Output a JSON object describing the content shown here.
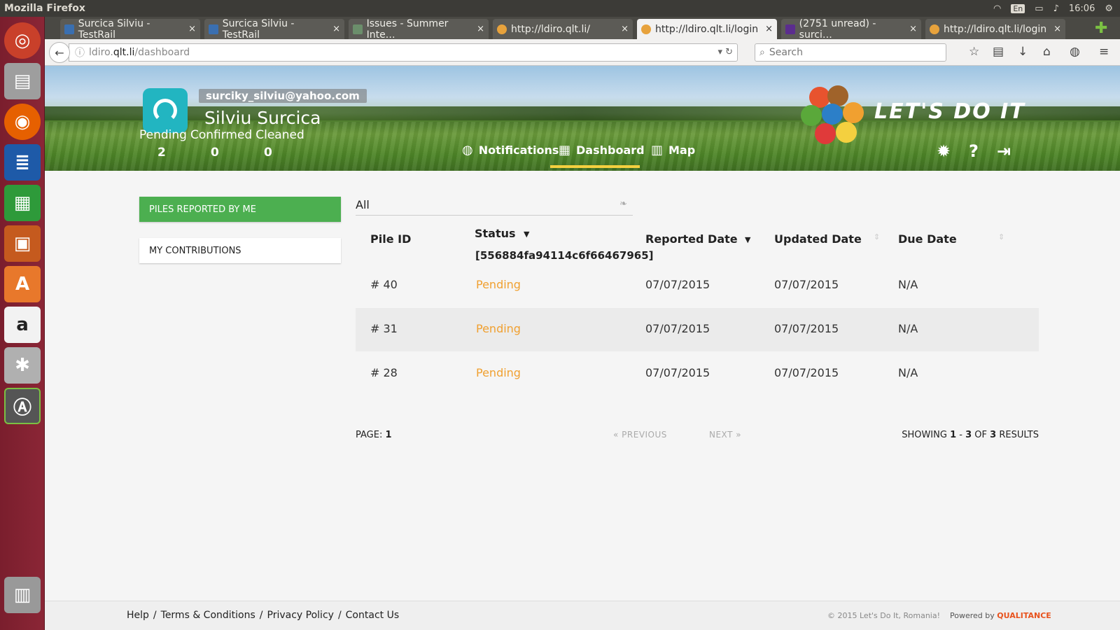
{
  "os": {
    "app_title": "Mozilla Firefox",
    "lang": "En",
    "time": "16:06"
  },
  "tabs": [
    {
      "title": "Surcica Silviu - TestRail",
      "close": "×"
    },
    {
      "title": "Surcica Silviu - TestRail",
      "close": "×"
    },
    {
      "title": "Issues - Summer Inte…",
      "close": "×"
    },
    {
      "title": "http://ldiro.qlt.li/",
      "close": "×"
    },
    {
      "title": "http://ldiro.qlt.li/login",
      "close": "×"
    },
    {
      "title": "(2751 unread) - surci…",
      "close": "×"
    },
    {
      "title": "http://ldiro.qlt.li/login",
      "close": "×"
    }
  ],
  "url": {
    "host": "ldiro.qlt.li",
    "path": "/dashboard",
    "sub": "ldiro.",
    "domain": "qlt.li"
  },
  "search": {
    "placeholder": "Search"
  },
  "profile": {
    "email": "surciky_silviu@yahoo.com",
    "name": "Silviu Surcica",
    "stat_labels": [
      "Pending",
      "Confirmed",
      "Cleaned"
    ],
    "stat_values": [
      "2",
      "0",
      "0"
    ]
  },
  "menu": {
    "notifications": "Notifications",
    "dashboard": "Dashboard",
    "map": "Map"
  },
  "logo": {
    "text": "LET'S DO IT"
  },
  "sidebar": {
    "piles_reported": "PILES REPORTED BY ME",
    "contributions": "MY CONTRIBUTIONS"
  },
  "filter": {
    "value": "All"
  },
  "table": {
    "headers": {
      "pile_id": "Pile ID",
      "status": "Status",
      "status_sub": "[556884fa94114c6f66467965]",
      "reported": "Reported Date",
      "updated": "Updated Date",
      "due": "Due Date"
    },
    "rows": [
      {
        "id": "# 40",
        "status": "Pending",
        "reported": "07/07/2015",
        "updated": "07/07/2015",
        "due": "N/A"
      },
      {
        "id": "# 31",
        "status": "Pending",
        "reported": "07/07/2015",
        "updated": "07/07/2015",
        "due": "N/A"
      },
      {
        "id": "# 28",
        "status": "Pending",
        "reported": "07/07/2015",
        "updated": "07/07/2015",
        "due": "N/A"
      }
    ]
  },
  "pager": {
    "label": "PAGE:",
    "page": "1",
    "previous": "« PREVIOUS",
    "next": "NEXT »",
    "showing": "SHOWING",
    "from": "1",
    "to": "3",
    "of": "OF",
    "total": "3",
    "results": "RESULTS"
  },
  "footer": {
    "links": [
      "Help",
      "Terms & Conditions",
      "Privacy Policy",
      "Contact Us"
    ],
    "separator": "/",
    "copyright": "© 2015 Let's Do It, Romania!",
    "powered_by": "Powered by",
    "company": "QUALITANCE"
  },
  "colors": {
    "accent_green": "#4caf50",
    "pending_orange": "#f0a030",
    "dashboard_underline": "#f4d03f",
    "avatar_teal": "#22b5c1",
    "launcher": "#8b2636"
  }
}
